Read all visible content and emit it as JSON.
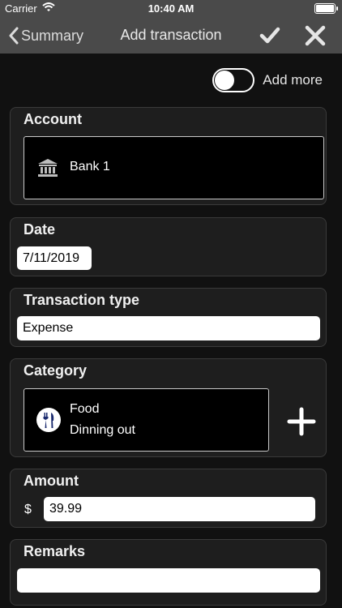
{
  "status_bar": {
    "carrier": "Carrier",
    "time": "10:40 AM"
  },
  "nav": {
    "back_label": "Summary",
    "title": "Add transaction"
  },
  "add_more": {
    "label": "Add more",
    "enabled": false
  },
  "account": {
    "heading": "Account",
    "value": "Bank 1",
    "icon": "bank-icon"
  },
  "date": {
    "heading": "Date",
    "value": "7/11/2019"
  },
  "transaction_type": {
    "heading": "Transaction type",
    "value": "Expense"
  },
  "category": {
    "heading": "Category",
    "name": "Food",
    "subcategory": "Dinning out",
    "icon": "utensils-icon"
  },
  "amount": {
    "heading": "Amount",
    "currency": "$",
    "value": "39.99"
  },
  "remarks": {
    "heading": "Remarks",
    "value": ""
  }
}
